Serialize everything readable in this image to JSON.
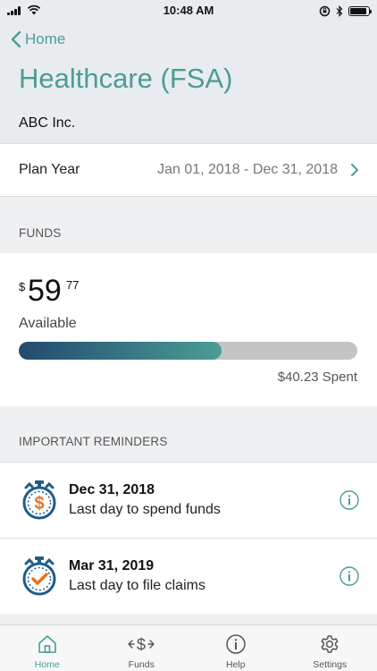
{
  "status_bar": {
    "time": "10:48 AM",
    "battery_level": 0.9
  },
  "nav": {
    "back_label": "Home"
  },
  "page": {
    "title": "Healthcare (FSA)",
    "company": "ABC Inc."
  },
  "plan_year": {
    "label": "Plan Year",
    "value": "Jan 01, 2018 - Dec 31, 2018"
  },
  "funds": {
    "section_title": "FUNDS",
    "currency_symbol": "$",
    "amount_whole": "59",
    "amount_cents": "77",
    "available_label": "Available",
    "spent_text": "$40.23 Spent",
    "available_fraction": 0.598
  },
  "reminders": {
    "section_title": "IMPORTANT REMINDERS",
    "items": [
      {
        "date": "Dec 31, 2018",
        "text": "Last day to spend funds",
        "icon": "stopwatch-dollar-icon"
      },
      {
        "date": "Mar 31, 2019",
        "text": "Last day to file claims",
        "icon": "stopwatch-check-icon"
      }
    ]
  },
  "tabs": [
    {
      "label": "Home",
      "icon": "home-icon",
      "active": true
    },
    {
      "label": "Funds",
      "icon": "funds-icon",
      "active": false
    },
    {
      "label": "Help",
      "icon": "info-icon",
      "active": false
    },
    {
      "label": "Settings",
      "icon": "gear-icon",
      "active": false
    }
  ],
  "colors": {
    "accent": "#4b9d95",
    "progress_start": "#234a70",
    "progress_track": "#c4c4c4",
    "dollar_orange": "#e8731c",
    "icon_blue": "#1f5c8a"
  }
}
